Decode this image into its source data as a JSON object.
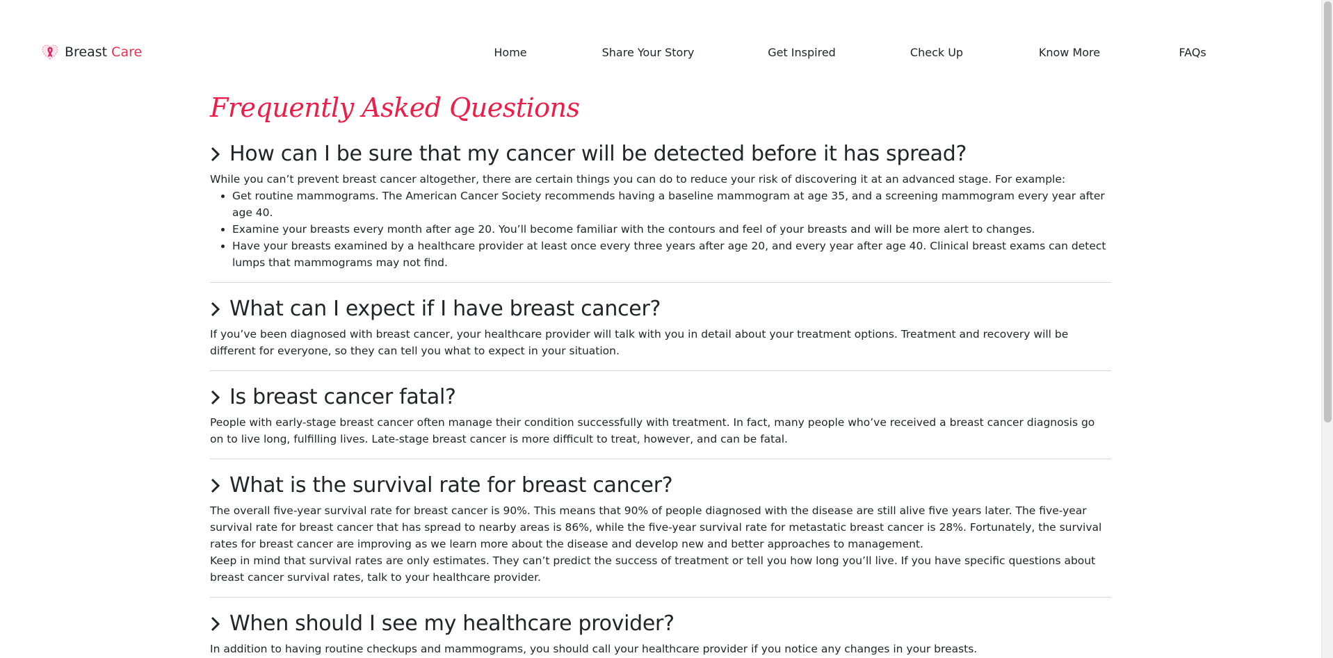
{
  "brand": {
    "name_part1": "Breast",
    "name_part2": "Care",
    "logo_icon": "pink-ribbon-heart-icon"
  },
  "nav": {
    "items": [
      {
        "label": "Home"
      },
      {
        "label": "Share Your Story"
      },
      {
        "label": "Get Inspired"
      },
      {
        "label": "Check Up"
      },
      {
        "label": "Know More"
      },
      {
        "label": "FAQs"
      }
    ]
  },
  "page": {
    "title": "Frequently Asked Questions",
    "accent_color": "#ee1c48"
  },
  "faqs": [
    {
      "question": "How can I be sure that my cancer will be detected before it has spread?",
      "intro": "While you can’t prevent breast cancer altogether, there are certain things you can do to reduce your risk of discovering it at an advanced stage. For example:",
      "bullets": [
        "Get routine mammograms. The American Cancer Society recommends having a baseline mammogram at age 35, and a screening mammogram every year after age 40.",
        "Examine your breasts every month after age 20. You’ll become familiar with the contours and feel of your breasts and will be more alert to changes.",
        "Have your breasts examined by a healthcare provider at least once every three years after age 20, and every year after age 40. Clinical breast exams can detect lumps that mammograms may not find."
      ]
    },
    {
      "question": "What can I expect if I have breast cancer?",
      "answer": "If you’ve been diagnosed with breast cancer, your healthcare provider will talk with you in detail about your treatment options. Treatment and recovery will be different for everyone, so they can tell you what to expect in your situation."
    },
    {
      "question": "Is breast cancer fatal?",
      "answer": "People with early-stage breast cancer often manage their condition successfully with treatment. In fact, many people who’ve received a breast cancer diagnosis go on to live long, fulfilling lives. Late-stage breast cancer is more difficult to treat, however, and can be fatal."
    },
    {
      "question": "What is the survival rate for breast cancer?",
      "answer": "The overall five-year survival rate for breast cancer is 90%. This means that 90% of people diagnosed with the disease are still alive five years later. The five-year survival rate for breast cancer that has spread to nearby areas is 86%, while the five-year survival rate for metastatic breast cancer is 28%. Fortunately, the survival rates for breast cancer are improving as we learn more about the disease and develop new and better approaches to management.",
      "answer2": "Keep in mind that survival rates are only estimates. They can’t predict the success of treatment or tell you how long you’ll live. If you have specific questions about breast cancer survival rates, talk to your healthcare provider."
    },
    {
      "question": "When should I see my healthcare provider?",
      "answer": "In addition to having routine checkups and mammograms, you should call your healthcare provider if you notice any changes in your breasts."
    }
  ],
  "icons": {
    "chevron": "chevron-right-icon"
  }
}
